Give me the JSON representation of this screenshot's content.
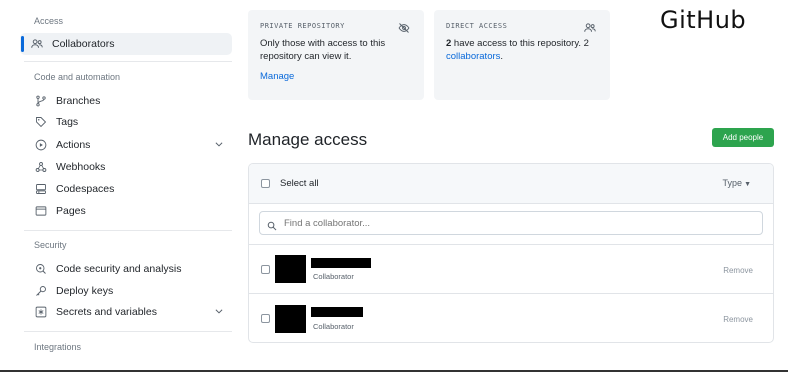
{
  "sidebar": {
    "access_heading": "Access",
    "collaborators_label": "Collaborators",
    "code_heading": "Code and automation",
    "items": [
      {
        "label": "Branches",
        "icon": "branch-icon"
      },
      {
        "label": "Tags",
        "icon": "tag-icon"
      },
      {
        "label": "Actions",
        "icon": "play-icon"
      },
      {
        "label": "Webhooks",
        "icon": "webhook-icon"
      },
      {
        "label": "Codespaces",
        "icon": "codespaces-icon"
      },
      {
        "label": "Pages",
        "icon": "browser-icon"
      }
    ],
    "security_heading": "Security",
    "security_items": [
      {
        "label": "Code security and analysis",
        "icon": "codescan-icon"
      },
      {
        "label": "Deploy keys",
        "icon": "key-icon"
      },
      {
        "label": "Secrets and variables",
        "icon": "asterisk-icon"
      }
    ],
    "integrations_heading": "Integrations"
  },
  "cards": {
    "private": {
      "label": "PRIVATE REPOSITORY",
      "text": "Only those with access to this repository can view it.",
      "link": "Manage",
      "icon": "eye-closed-icon"
    },
    "direct": {
      "label": "DIRECT ACCESS",
      "text_bold": "2",
      "text_rest": " have access to this repository. 2 ",
      "text_link": "collaborators",
      "text_end": ".",
      "icon": "people-icon"
    }
  },
  "logo": "GitHub",
  "main": {
    "title": "Manage access",
    "add_button": "Add people",
    "select_all": "Select all",
    "type_filter": "Type",
    "search_placeholder": "Find a collaborator...",
    "rows": [
      {
        "role": "Collaborator",
        "remove": "Remove"
      },
      {
        "role": "Collaborator",
        "remove": "Remove"
      }
    ]
  },
  "colors": {
    "accent": "#0969da",
    "add_button": "#2da44e"
  }
}
